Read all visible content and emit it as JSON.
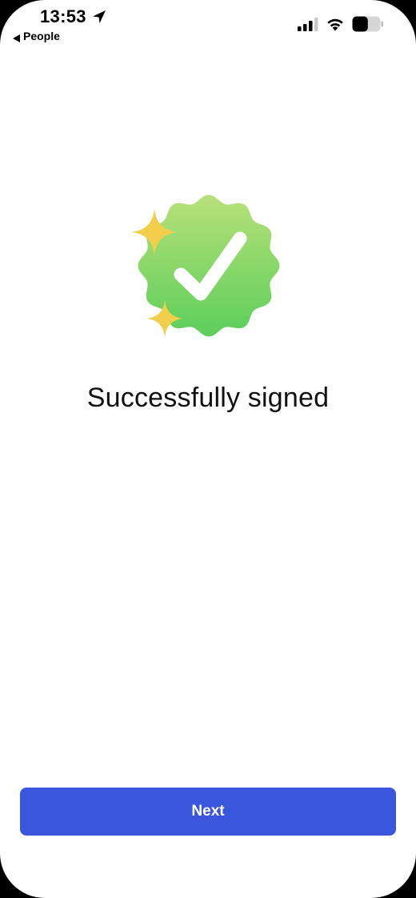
{
  "status_bar": {
    "time": "13:53",
    "location_icon": "location-arrow-icon",
    "signal_icon": "cellular-signal-icon",
    "wifi_icon": "wifi-icon",
    "battery_icon": "battery-icon",
    "battery_level": 0.55
  },
  "nav": {
    "back_label": "People",
    "back_icon": "back-triangle-icon"
  },
  "badge": {
    "icon": "verified-check-badge-icon",
    "sparkle_icon": "sparkle-icon",
    "colors": {
      "badge_top": "#b8e07a",
      "badge_bottom": "#5ccf5a",
      "check": "#ffffff",
      "sparkle": "#f1cf4a"
    }
  },
  "main": {
    "title": "Successfully signed"
  },
  "footer": {
    "next_label": "Next",
    "button_color": "#3a56dd"
  }
}
